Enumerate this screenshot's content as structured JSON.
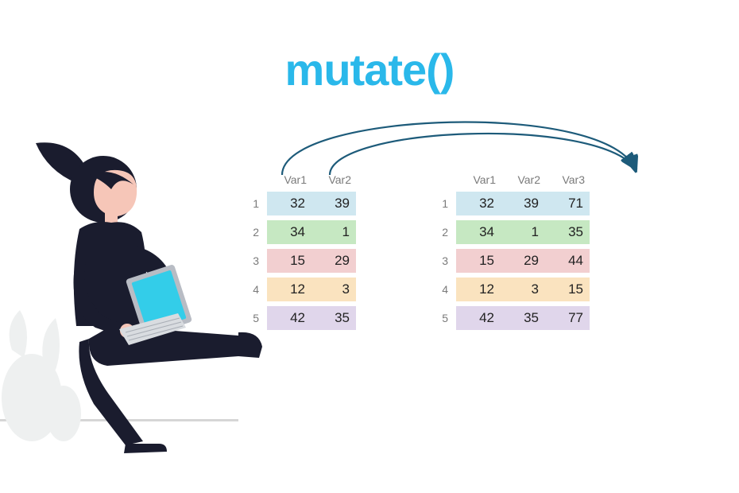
{
  "title": {
    "text": "mutate()",
    "color": "#2AB8EA"
  },
  "rowColors": [
    "#cfe7f0",
    "#c6e8c2",
    "#f2cfd0",
    "#fae3bf",
    "#e0d6eb"
  ],
  "arrowColor": "#1d5b7a",
  "tables": {
    "left": {
      "headers": [
        "Var1",
        "Var2"
      ],
      "rows": [
        {
          "idx": "1",
          "vals": [
            "32",
            "39"
          ]
        },
        {
          "idx": "2",
          "vals": [
            "34",
            "1"
          ]
        },
        {
          "idx": "3",
          "vals": [
            "15",
            "29"
          ]
        },
        {
          "idx": "4",
          "vals": [
            "12",
            "3"
          ]
        },
        {
          "idx": "5",
          "vals": [
            "42",
            "35"
          ]
        }
      ]
    },
    "right": {
      "headers": [
        "Var1",
        "Var2",
        "Var3"
      ],
      "rows": [
        {
          "idx": "1",
          "vals": [
            "32",
            "39",
            "71"
          ]
        },
        {
          "idx": "2",
          "vals": [
            "34",
            "1",
            "35"
          ]
        },
        {
          "idx": "3",
          "vals": [
            "15",
            "29",
            "44"
          ]
        },
        {
          "idx": "4",
          "vals": [
            "12",
            "3",
            "15"
          ]
        },
        {
          "idx": "5",
          "vals": [
            "42",
            "35",
            "77"
          ]
        }
      ]
    }
  },
  "illustration": {
    "description": "woman-with-laptop-sitting",
    "palette": {
      "suit": "#1a1c2e",
      "skin": "#f6c6b8",
      "accent": "#29c2e8",
      "laptop": "#b8bcc4",
      "screen": "#33cde9",
      "plant": "#eef0f0"
    }
  }
}
